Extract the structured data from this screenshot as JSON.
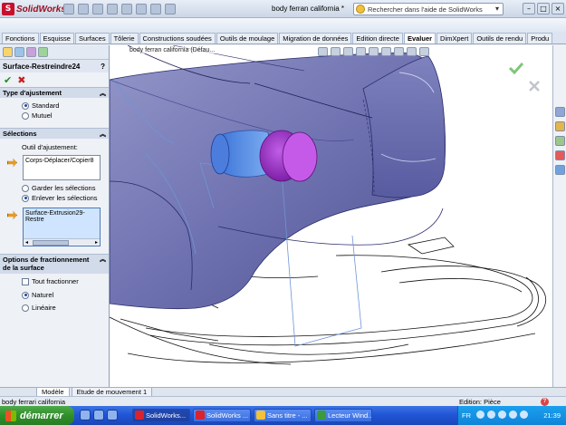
{
  "titlebar": {
    "app": "SolidWorks",
    "doc_title": "body ferran california *",
    "search_placeholder": "Rechercher dans l'aide de SolidWorks"
  },
  "tabs": [
    {
      "label": "Fonctions",
      "active": false
    },
    {
      "label": "Esquisse",
      "active": false
    },
    {
      "label": "Surfaces",
      "active": false
    },
    {
      "label": "Tôlerie",
      "active": false
    },
    {
      "label": "Constructions soudées",
      "active": false
    },
    {
      "label": "Outils de moulage",
      "active": false
    },
    {
      "label": "Migration de données",
      "active": false
    },
    {
      "label": "Edition directe",
      "active": false
    },
    {
      "label": "Evaluer",
      "active": true
    },
    {
      "label": "DimXpert",
      "active": false
    },
    {
      "label": "Outils de rendu",
      "active": false
    },
    {
      "label": "Produ",
      "active": false
    }
  ],
  "panel": {
    "feature_title": "Surface-Restreindre24",
    "help": "?",
    "ok": "✔",
    "cancel": "✖",
    "type_header": "Type d'ajustement",
    "type_options": [
      "Standard",
      "Mutuel"
    ],
    "type_selected": "Standard",
    "selections_header": "Sélections",
    "tool_label": "Outil d'ajustement:",
    "tool_value": "Corps-Déplacer/Copier8",
    "keep_option": "Garder les sélections",
    "remove_option": "Enlever les sélections",
    "keep_selected": "Enlever les sélections",
    "selection_value": "Surface-Extrusion29-Restre",
    "split_header": "Options de fractionnement de la surface",
    "split_all": "Tout fractionner",
    "split_options": [
      "Naturel",
      "Linéaire"
    ],
    "split_selected": "Naturel"
  },
  "viewport": {
    "doc_label": "body ferran california (Défau..."
  },
  "bottom_tabs": [
    {
      "label": "Modèle",
      "active": true
    },
    {
      "label": "Etude de mouvement 1",
      "active": false
    }
  ],
  "status": {
    "left": "body ferrari california",
    "right": "Edition: Pièce",
    "help": "?"
  },
  "taskbar": {
    "start": "démarrer",
    "tasks": [
      "SolidWorks...",
      "SolidWorks ...",
      "Sans titre - ...",
      "Lecteur Wind..."
    ],
    "lang": "FR",
    "clock": "21:39"
  },
  "colors": {
    "part_fill": "#6f72b0",
    "selected_surface": "#9b2fc4",
    "accent_surface": "#5b8fe0"
  }
}
